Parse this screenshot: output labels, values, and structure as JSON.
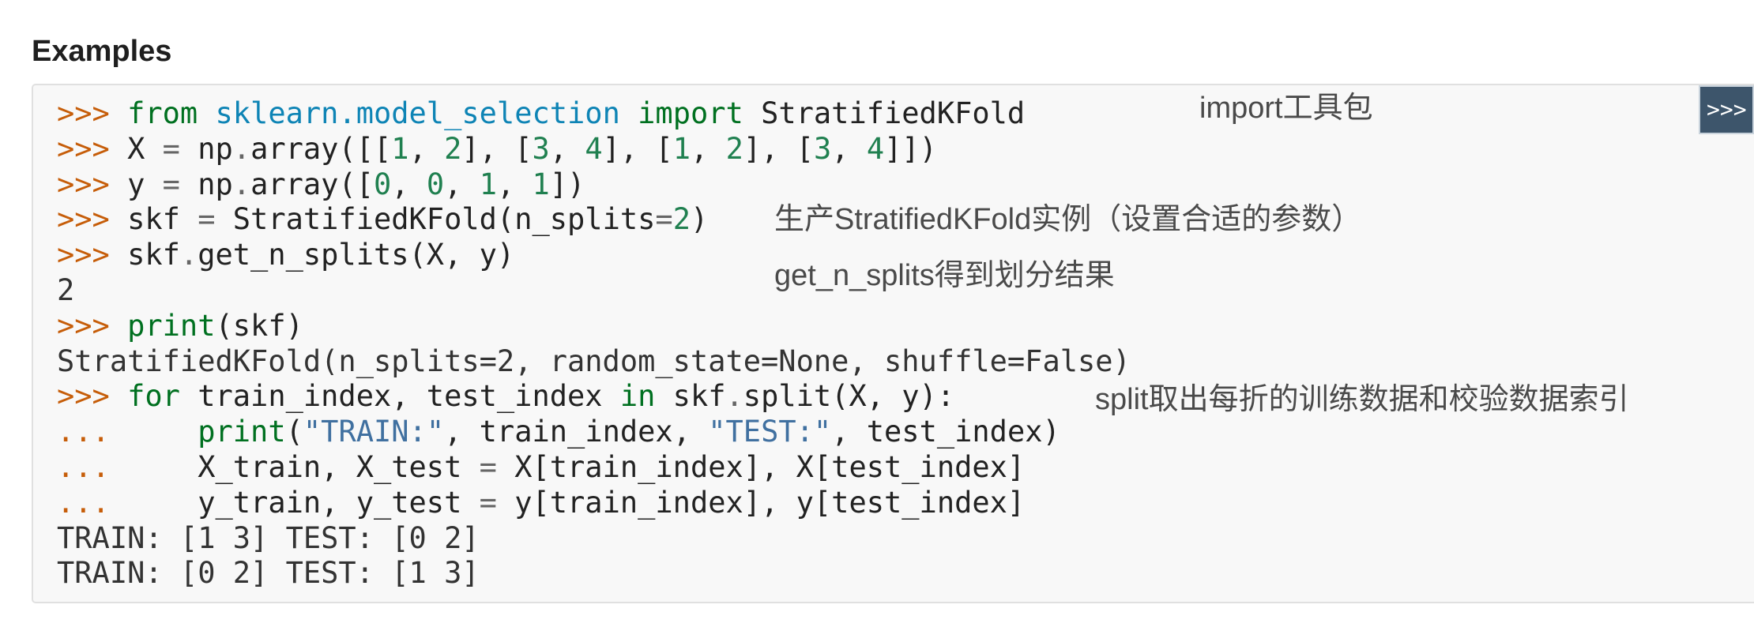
{
  "heading": "Examples",
  "copy_toggle_label": ">>>",
  "code_lines": [
    [
      {
        "t": "prompt",
        "v": ">>> "
      },
      {
        "t": "kw",
        "v": "from"
      },
      {
        "t": "plain",
        "v": " "
      },
      {
        "t": "ns",
        "v": "sklearn.model_selection"
      },
      {
        "t": "plain",
        "v": " "
      },
      {
        "t": "kw",
        "v": "import"
      },
      {
        "t": "plain",
        "v": " StratifiedKFold"
      }
    ],
    [
      {
        "t": "prompt",
        "v": ">>> "
      },
      {
        "t": "plain",
        "v": "X "
      },
      {
        "t": "op",
        "v": "="
      },
      {
        "t": "plain",
        "v": " np"
      },
      {
        "t": "op",
        "v": "."
      },
      {
        "t": "plain",
        "v": "array([["
      },
      {
        "t": "num",
        "v": "1"
      },
      {
        "t": "plain",
        "v": ", "
      },
      {
        "t": "num",
        "v": "2"
      },
      {
        "t": "plain",
        "v": "], ["
      },
      {
        "t": "num",
        "v": "3"
      },
      {
        "t": "plain",
        "v": ", "
      },
      {
        "t": "num",
        "v": "4"
      },
      {
        "t": "plain",
        "v": "], ["
      },
      {
        "t": "num",
        "v": "1"
      },
      {
        "t": "plain",
        "v": ", "
      },
      {
        "t": "num",
        "v": "2"
      },
      {
        "t": "plain",
        "v": "], ["
      },
      {
        "t": "num",
        "v": "3"
      },
      {
        "t": "plain",
        "v": ", "
      },
      {
        "t": "num",
        "v": "4"
      },
      {
        "t": "plain",
        "v": "]])"
      }
    ],
    [
      {
        "t": "prompt",
        "v": ">>> "
      },
      {
        "t": "plain",
        "v": "y "
      },
      {
        "t": "op",
        "v": "="
      },
      {
        "t": "plain",
        "v": " np"
      },
      {
        "t": "op",
        "v": "."
      },
      {
        "t": "plain",
        "v": "array(["
      },
      {
        "t": "num",
        "v": "0"
      },
      {
        "t": "plain",
        "v": ", "
      },
      {
        "t": "num",
        "v": "0"
      },
      {
        "t": "plain",
        "v": ", "
      },
      {
        "t": "num",
        "v": "1"
      },
      {
        "t": "plain",
        "v": ", "
      },
      {
        "t": "num",
        "v": "1"
      },
      {
        "t": "plain",
        "v": "])"
      }
    ],
    [
      {
        "t": "prompt",
        "v": ">>> "
      },
      {
        "t": "plain",
        "v": "skf "
      },
      {
        "t": "op",
        "v": "="
      },
      {
        "t": "plain",
        "v": " StratifiedKFold(n_splits"
      },
      {
        "t": "op",
        "v": "="
      },
      {
        "t": "num",
        "v": "2"
      },
      {
        "t": "plain",
        "v": ")"
      }
    ],
    [
      {
        "t": "prompt",
        "v": ">>> "
      },
      {
        "t": "plain",
        "v": "skf"
      },
      {
        "t": "op",
        "v": "."
      },
      {
        "t": "plain",
        "v": "get_n_splits(X, y)"
      }
    ],
    [
      {
        "t": "out",
        "v": "2"
      }
    ],
    [
      {
        "t": "prompt",
        "v": ">>> "
      },
      {
        "t": "kw",
        "v": "print"
      },
      {
        "t": "plain",
        "v": "(skf)"
      }
    ],
    [
      {
        "t": "out",
        "v": "StratifiedKFold(n_splits=2, random_state=None, shuffle=False)"
      }
    ],
    [
      {
        "t": "prompt",
        "v": ">>> "
      },
      {
        "t": "kw",
        "v": "for"
      },
      {
        "t": "plain",
        "v": " train_index, test_index "
      },
      {
        "t": "kw",
        "v": "in"
      },
      {
        "t": "plain",
        "v": " skf"
      },
      {
        "t": "op",
        "v": "."
      },
      {
        "t": "plain",
        "v": "split(X, y):"
      }
    ],
    [
      {
        "t": "prompt",
        "v": "...     "
      },
      {
        "t": "kw",
        "v": "print"
      },
      {
        "t": "plain",
        "v": "("
      },
      {
        "t": "str",
        "v": "\"TRAIN:\""
      },
      {
        "t": "plain",
        "v": ", train_index, "
      },
      {
        "t": "str",
        "v": "\"TEST:\""
      },
      {
        "t": "plain",
        "v": ", test_index)"
      }
    ],
    [
      {
        "t": "prompt",
        "v": "...     "
      },
      {
        "t": "plain",
        "v": "X_train, X_test "
      },
      {
        "t": "op",
        "v": "="
      },
      {
        "t": "plain",
        "v": " X[train_index], X[test_index]"
      }
    ],
    [
      {
        "t": "prompt",
        "v": "...     "
      },
      {
        "t": "plain",
        "v": "y_train, y_test "
      },
      {
        "t": "op",
        "v": "="
      },
      {
        "t": "plain",
        "v": " y[train_index], y[test_index]"
      }
    ],
    [
      {
        "t": "out",
        "v": "TRAIN: [1 3] TEST: [0 2]"
      }
    ],
    [
      {
        "t": "out",
        "v": "TRAIN: [0 2] TEST: [1 3]"
      }
    ]
  ],
  "annotations": {
    "import_note": "import工具包",
    "instance_note": "生产StratifiedKFold实例（设置合适的参数）",
    "get_splits_note": "get_n_splits得到划分结果",
    "split_note": "split取出每折的训练数据和校验数据索引"
  },
  "colors": {
    "prompt": "#c65d09",
    "keyword": "#007020",
    "namespace": "#0e84b5",
    "number": "#208050",
    "string": "#4070a0",
    "code_background": "#f8f8f8",
    "toggle_background": "#3d556b"
  }
}
